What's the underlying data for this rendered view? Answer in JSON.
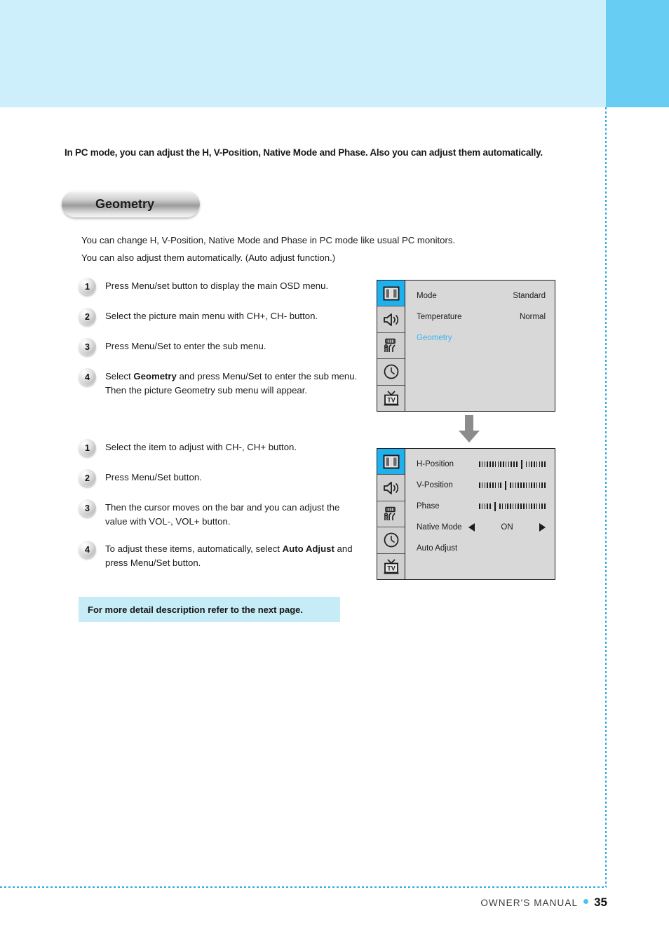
{
  "page": {
    "intro": "In PC mode, you can adjust the H, V-Position, Native Mode and Phase. Also you can adjust them automatically.",
    "section_title": "Geometry",
    "lead_line1": "You can change H, V-Position, Native Mode and Phase in PC mode like usual PC monitors.",
    "lead_line2": "You can also adjust them automatically. (Auto adjust function.)",
    "note": "For more detail description refer to the next page."
  },
  "colors": {
    "header_light": "#cdeefb",
    "header_dark": "#68cdf2",
    "note_bg": "#c6ecf8",
    "osd_highlight": "#1fb0ee",
    "osd_selected_text": "#3cb4ec",
    "footer_dot": "#4fc2ef"
  },
  "steps_first": [
    {
      "num": "1",
      "text": "Press Menu/set button to display the main OSD menu."
    },
    {
      "num": "2",
      "text": "Select the picture main menu  with CH+, CH- button."
    },
    {
      "num": "3",
      "text": "Press Menu/Set to enter the sub menu."
    },
    {
      "num": "4",
      "text": "Select <b>Geometry</b> and press Menu/Set to enter the sub menu. Then the picture Geometry sub menu will appear."
    }
  ],
  "steps_second": [
    {
      "num": "1",
      "text": "Select the item to adjust with CH-, CH+ button."
    },
    {
      "num": "2",
      "text": "Press Menu/Set button."
    },
    {
      "num": "3",
      "text": "Then the cursor moves on the bar and you can adjust the value with VOL-, VOL+ button."
    },
    {
      "num": "4",
      "text": "To adjust these items, automatically, select <b>Auto Adjust</b> and press Menu/Set button."
    }
  ],
  "osd_icons": [
    {
      "name": "picture-icon",
      "active": true
    },
    {
      "name": "sound-speaker-icon",
      "active": false
    },
    {
      "name": "setup-tools-icon",
      "active": false
    },
    {
      "name": "clock-timer-icon",
      "active": false
    },
    {
      "name": "tv-channel-icon",
      "active": false
    }
  ],
  "osd_main": {
    "rows": [
      {
        "label": "Mode",
        "value": "Standard",
        "highlight": false
      },
      {
        "label": "Temperature",
        "value": "Normal",
        "highlight": false
      },
      {
        "label": "Geometry",
        "value": "",
        "highlight": true
      }
    ]
  },
  "osd_sub": {
    "rows": [
      {
        "label": "H-Position",
        "type": "slider",
        "cursor_pct": 62
      },
      {
        "label": "V-Position",
        "type": "slider",
        "cursor_pct": 38
      },
      {
        "label": "Phase",
        "type": "slider",
        "cursor_pct": 22
      },
      {
        "label": "Native Mode",
        "type": "toggle",
        "value": "ON"
      },
      {
        "label": "Auto Adjust",
        "type": "action",
        "value": ""
      }
    ]
  },
  "footer": {
    "label": "OWNER'S MANUAL",
    "page": "35"
  }
}
